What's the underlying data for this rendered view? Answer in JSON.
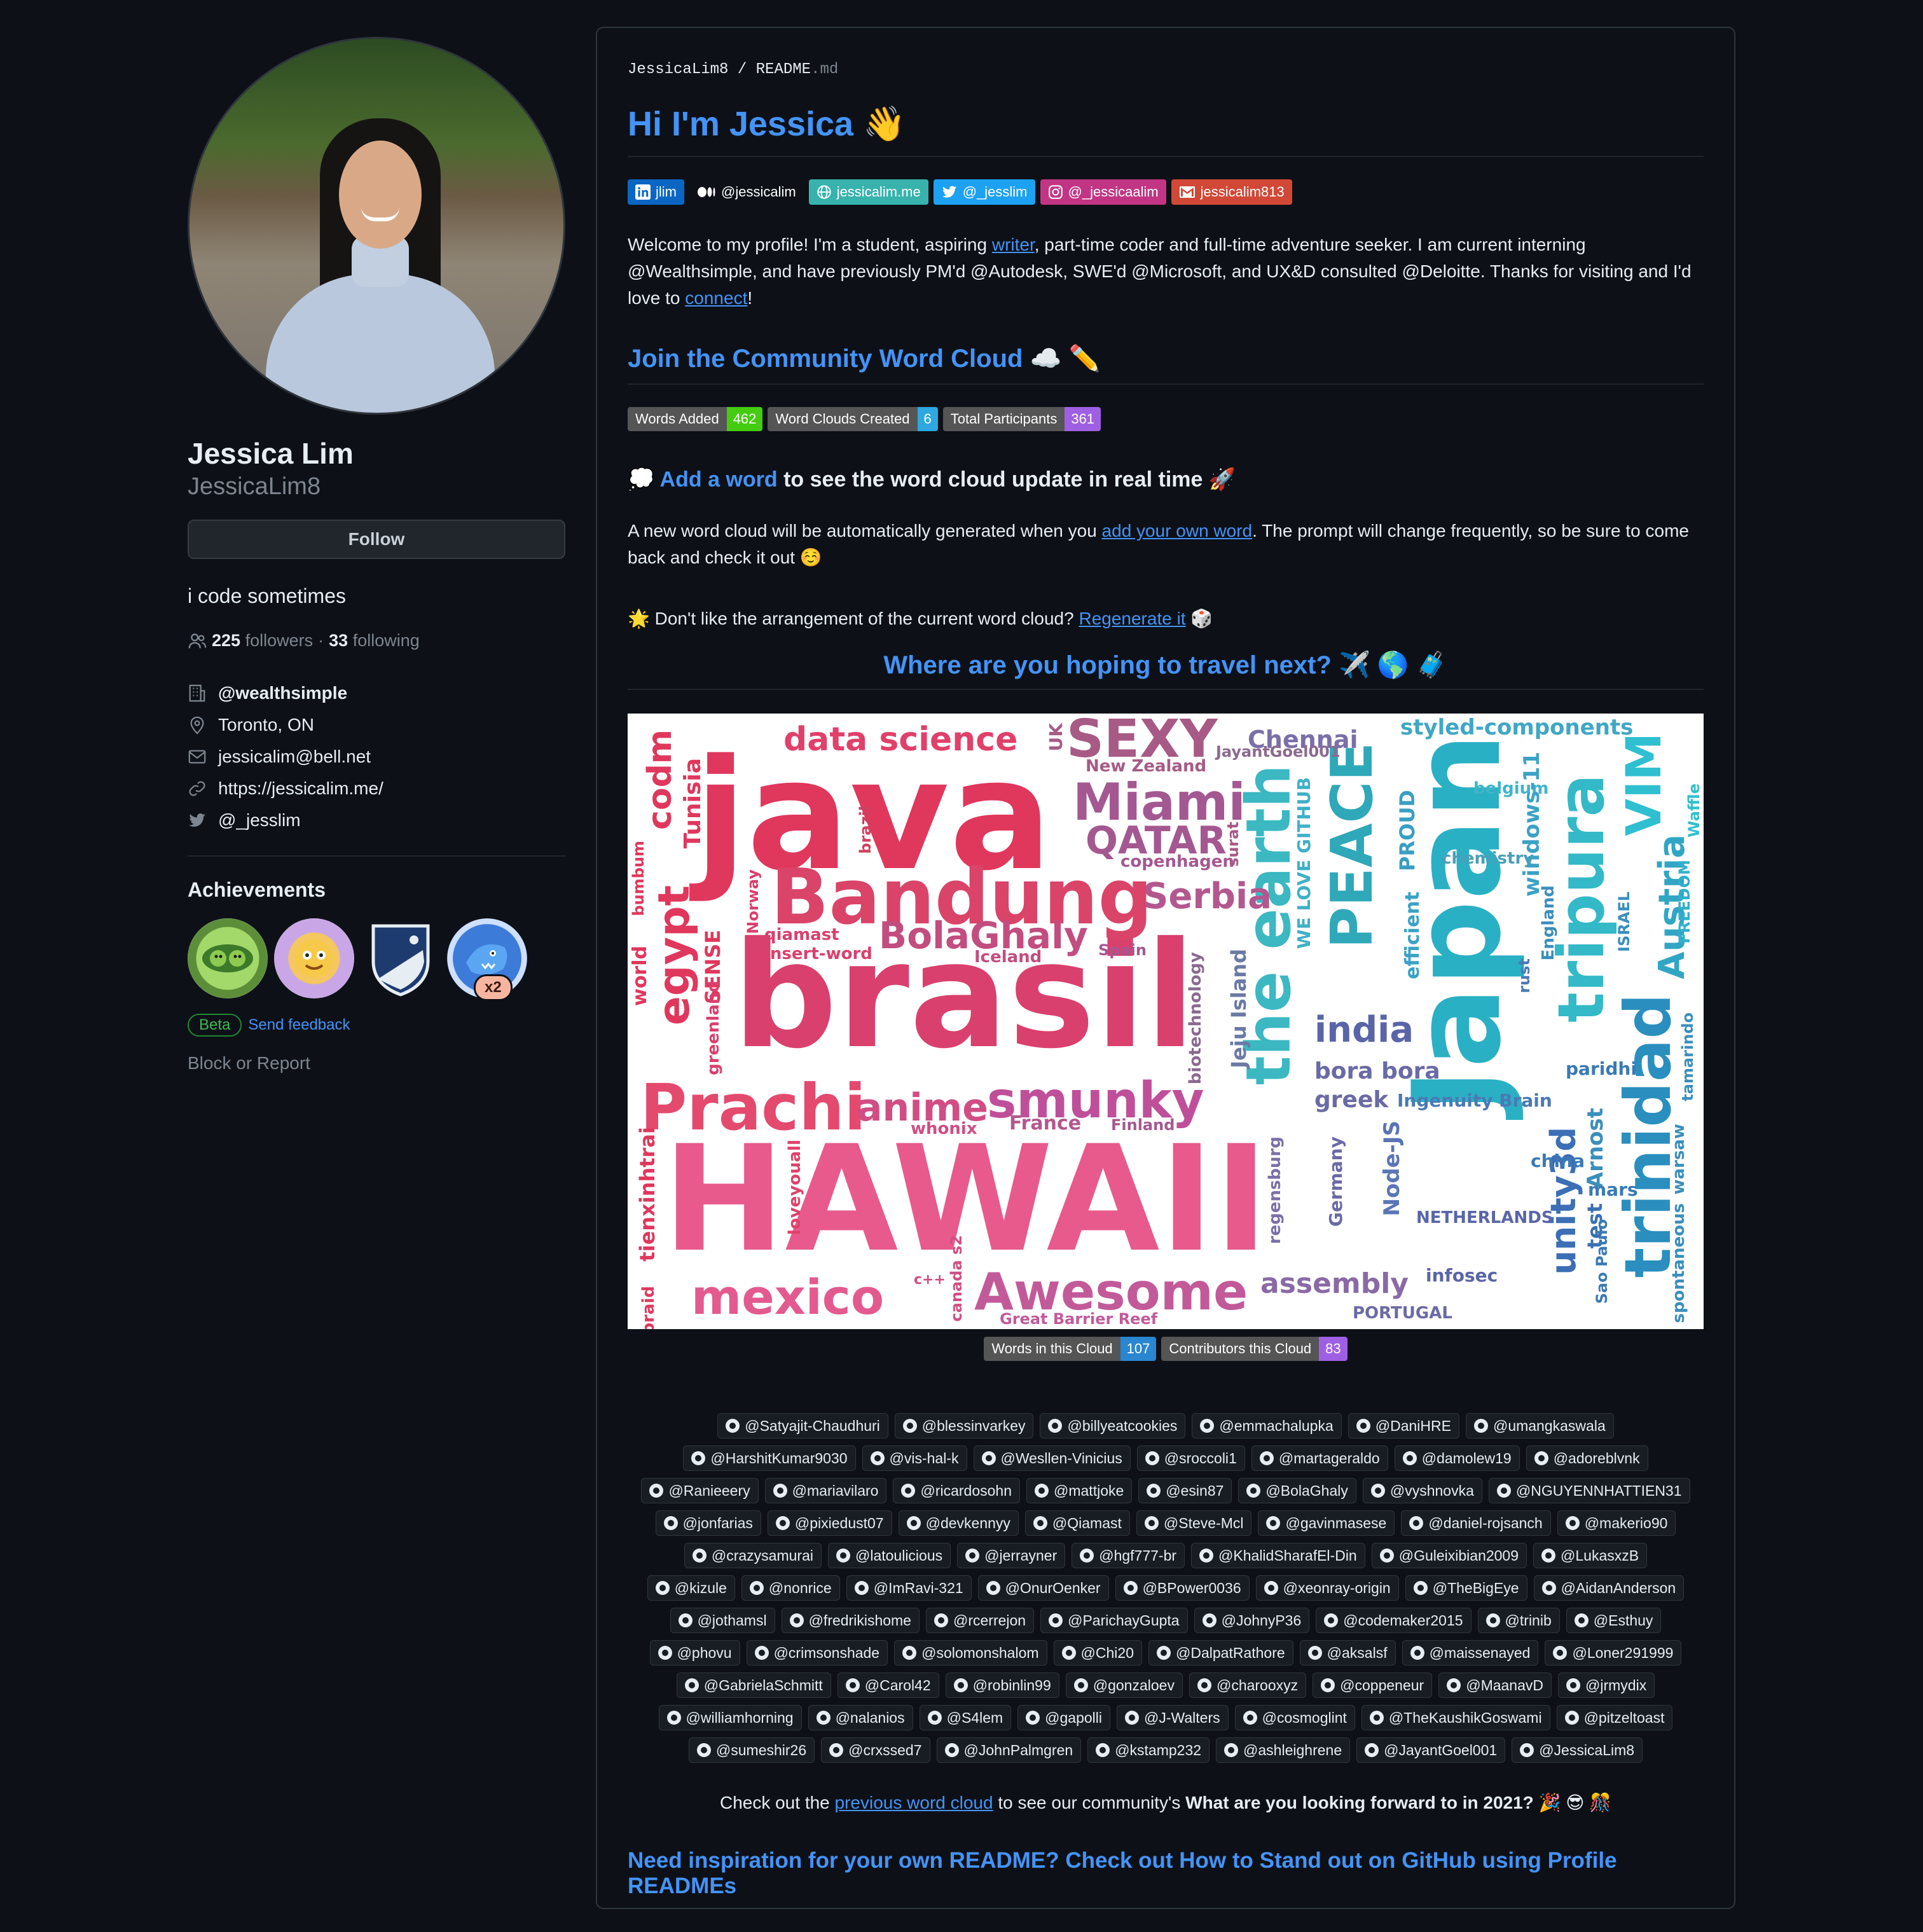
{
  "profile": {
    "name": "Jessica Lim",
    "login": "JessicaLim8",
    "follow_label": "Follow",
    "bio": "i code sometimes",
    "followers_count": "225",
    "followers_label": "followers",
    "separator": "·",
    "following_count": "33",
    "following_label": "following",
    "details": [
      {
        "icon": "building-icon",
        "text": "@wealthsimple"
      },
      {
        "icon": "location-icon",
        "text": "Toronto, ON"
      },
      {
        "icon": "mail-icon",
        "text": "jessicalim@bell.net"
      },
      {
        "icon": "link-icon",
        "text": "https://jessicalim.me/"
      },
      {
        "icon": "twitter-icon",
        "text": "@_jesslim"
      }
    ],
    "achievements_title": "Achievements",
    "achievement_multiplier": "x2",
    "beta_label": "Beta",
    "send_feedback": "Send feedback",
    "block_report": "Block or Report"
  },
  "readme": {
    "path_user": "JessicaLim8",
    "path_sep": "/",
    "path_file": "README",
    "path_ext": ".md",
    "title": "Hi I'm Jessica 👋",
    "social_badges": [
      {
        "label": "jlim",
        "color": "#0a66c2",
        "icon": "linkedin-icon"
      },
      {
        "label": "@jessicalim",
        "color": "#0d1117",
        "icon": "medium-icon"
      },
      {
        "label": "jessicalim.me",
        "color": "#38b2ac",
        "icon": "globe-icon"
      },
      {
        "label": "@_jesslim",
        "color": "#1da1f2",
        "icon": "twitter-icon"
      },
      {
        "label": "@_jessicaalim",
        "color": "#c13584",
        "icon": "instagram-icon"
      },
      {
        "label": "jessicalim813",
        "color": "#d14836",
        "icon": "gmail-icon"
      }
    ],
    "intro_1": "Welcome to my profile! I'm a student, aspiring ",
    "intro_link_writer": "writer",
    "intro_2": ", part-time coder and full-time adventure seeker. I am current interning @Wealthsimple, and have previously PM'd @Autodesk, SWE'd @Microsoft, and UX&D consulted @Deloitte. Thanks for visiting and I'd love to ",
    "intro_link_connect": "connect",
    "intro_3": "!",
    "wc_heading": "Join the Community Word Cloud ☁️ ✏️",
    "stats_badges": [
      {
        "label": "Words Added",
        "value": "462",
        "color": "#4c1"
      },
      {
        "label": "Word Clouds Created",
        "value": "6",
        "color": "#2ea8e0"
      },
      {
        "label": "Total Participants",
        "value": "361",
        "color": "#9f5fe3"
      }
    ],
    "add_word_prefix": "💭 ",
    "add_word_link": "Add a word",
    "add_word_rest": " to see the word cloud update in real time 🚀",
    "gen_1": "A new word cloud will be automatically generated when you ",
    "gen_link": "add your own word",
    "gen_2": ". The prompt will change frequently, so be sure to come back and check it out ☺️",
    "regen_1": "🌟 Don't like the arrangement of the current word cloud? ",
    "regen_link": "Regenerate it",
    "regen_2": " 🎲",
    "prompt": "Where are you hoping to travel next? ✈️ 🌎 🧳",
    "cloud_badges": [
      {
        "label": "Words in this Cloud",
        "value": "107",
        "color": "#2a86d1"
      },
      {
        "label": "Contributors this Cloud",
        "value": "83",
        "color": "#9f5fe3"
      }
    ],
    "contributor_rows": [
      [
        "@Satyajit-Chaudhuri",
        "@blessinvarkey",
        "@billyeatcookies",
        "@emmachalupka",
        "@DaniHRE",
        "@umangkaswala"
      ],
      [
        "@HarshitKumar9030",
        "@vis-hal-k",
        "@Wesllen-Vinicius",
        "@sroccoli1",
        "@martageraldo",
        "@damolew19",
        "@adoreblvnk"
      ],
      [
        "@Ranieeery",
        "@mariavilaro",
        "@ricardosohn",
        "@mattjoke",
        "@esin87",
        "@BolaGhaly",
        "@vyshnovka",
        "@NGUYENNHATTIEN31"
      ],
      [
        "@jonfarias",
        "@pixiedust07",
        "@devkennyy",
        "@Qiamast",
        "@Steve-Mcl",
        "@gavinmasese",
        "@daniel-rojsanch",
        "@makerio90"
      ],
      [
        "@crazysamurai",
        "@latoulicious",
        "@jerrayner",
        "@hgf777-br",
        "@KhalidSharafEl-Din",
        "@Guleixibian2009",
        "@LukasxzB"
      ],
      [
        "@kizule",
        "@nonrice",
        "@ImRavi-321",
        "@OnurOenker",
        "@BPower0036",
        "@xeonray-origin",
        "@TheBigEye",
        "@AidanAnderson"
      ],
      [
        "@jothamsl",
        "@fredrikishome",
        "@rcerrejon",
        "@ParichayGupta",
        "@JohnyP36",
        "@codemaker2015",
        "@trinib",
        "@Esthuy"
      ],
      [
        "@phovu",
        "@crimsonshade",
        "@solomonshalom",
        "@Chi20",
        "@DalpatRathore",
        "@aksalsf",
        "@maissenayed",
        "@Loner291999"
      ],
      [
        "@GabrielaSchmitt",
        "@Carol42",
        "@robinlin99",
        "@gonzaloev",
        "@charooxyz",
        "@coppeneur",
        "@MaanavD",
        "@jrmydix"
      ],
      [
        "@williamhorning",
        "@nalanios",
        "@S4lem",
        "@gapolli",
        "@J-Walters",
        "@cosmoglint",
        "@TheKaushikGoswami",
        "@pitzeltoast"
      ],
      [
        "@sumeshir26",
        "@crxssed7",
        "@JohnPalmgren",
        "@kstamp232",
        "@ashleighrene",
        "@JayantGoel001",
        "@JessicaLim8"
      ]
    ],
    "prev_1": "Check out the ",
    "prev_link": "previous word cloud",
    "prev_2": " to see our community's ",
    "prev_bold": "What are you looking forward to in 2021? 🎉 😎 🎊",
    "inspiration": "Need inspiration for your own README? Check out How to Stand out on GitHub using Profile READMEs"
  },
  "word_cloud": {
    "words": [
      "java",
      "brasil",
      "HAWAII",
      "Japan",
      "Bandung",
      "Prachi",
      "mexico",
      "Awesome",
      "smunky",
      "PEACE",
      "tripura",
      "trinidad",
      "the earth",
      "Miami",
      "QATAR",
      "SEXY",
      "data science",
      "egypt",
      "codm",
      "Tunisia",
      "BolaGhaly",
      "Serbia",
      "india",
      "unity3d",
      "VIM",
      "Austria",
      "anime",
      "Chennai",
      "styled-components",
      "New Zealand",
      "JayantGoel001",
      "copenhagen",
      "brazil",
      "surat",
      "belgium",
      "windows-11",
      "chemistry",
      "Waffle",
      "FREEDOM",
      "ISRAEL",
      "England",
      "rust",
      "WE LOVE GITHUB",
      "PROUD",
      "efficient",
      "bumbum",
      "Norway",
      "qiamast",
      "insert-word",
      "Iceland",
      "Spain",
      "biotechnology",
      "Jeju Island",
      "SENSE",
      "greenland",
      "world",
      "bora bora",
      "greek",
      "Ingenuity Brain",
      "paridhi",
      "tamarindo",
      "France",
      "Finland",
      "whonix",
      "tienxinhtrai",
      "loveyouall",
      "regensburg",
      "Germany",
      "Node-JS",
      "NETHERLANDS",
      "china",
      "Arnost",
      "mars",
      "test",
      "Sao Paulo",
      "warsaw",
      "spontaneous",
      "infosec",
      "assembly",
      "PORTUGAL",
      "Great Barrier Reef",
      "canada s2",
      "c++",
      "braid",
      "UK"
    ]
  }
}
